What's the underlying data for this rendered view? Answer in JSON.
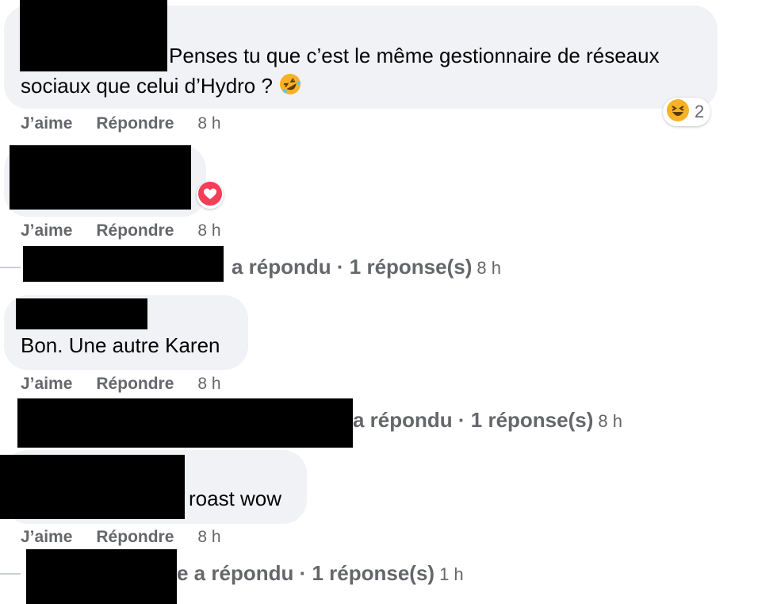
{
  "actions": {
    "like": "J’aime",
    "reply": "Répondre"
  },
  "comments": [
    {
      "text_line1": "Penses tu que c’est le même gestionnaire de réseaux",
      "text_line2": "sociaux que celui d’Hydro ?",
      "emoji": "rolling-on-floor-laughing",
      "reaction": {
        "emoji": "grinning-squinting-face",
        "count": "2"
      },
      "time": "8 h"
    },
    {
      "text": "",
      "reaction": {
        "emoji": "heart"
      },
      "time": "8 h"
    },
    {
      "text": "Bon. Une autre Karen",
      "time": "8 h"
    },
    {
      "text": "roast wow",
      "time": "8 h"
    }
  ],
  "reply_threads": [
    {
      "label": "a répondu · 1 réponse(s)",
      "time": "8 h"
    },
    {
      "label": "a répondu · 1 réponse(s)",
      "time": "8 h"
    },
    {
      "label": "e a répondu · 1 réponse(s)",
      "time": "1 h"
    }
  ],
  "colors": {
    "bubble": "#f0f2f5",
    "secondary_text": "#65676b",
    "heart": "#f33e58",
    "laugh": "#f7b125"
  }
}
